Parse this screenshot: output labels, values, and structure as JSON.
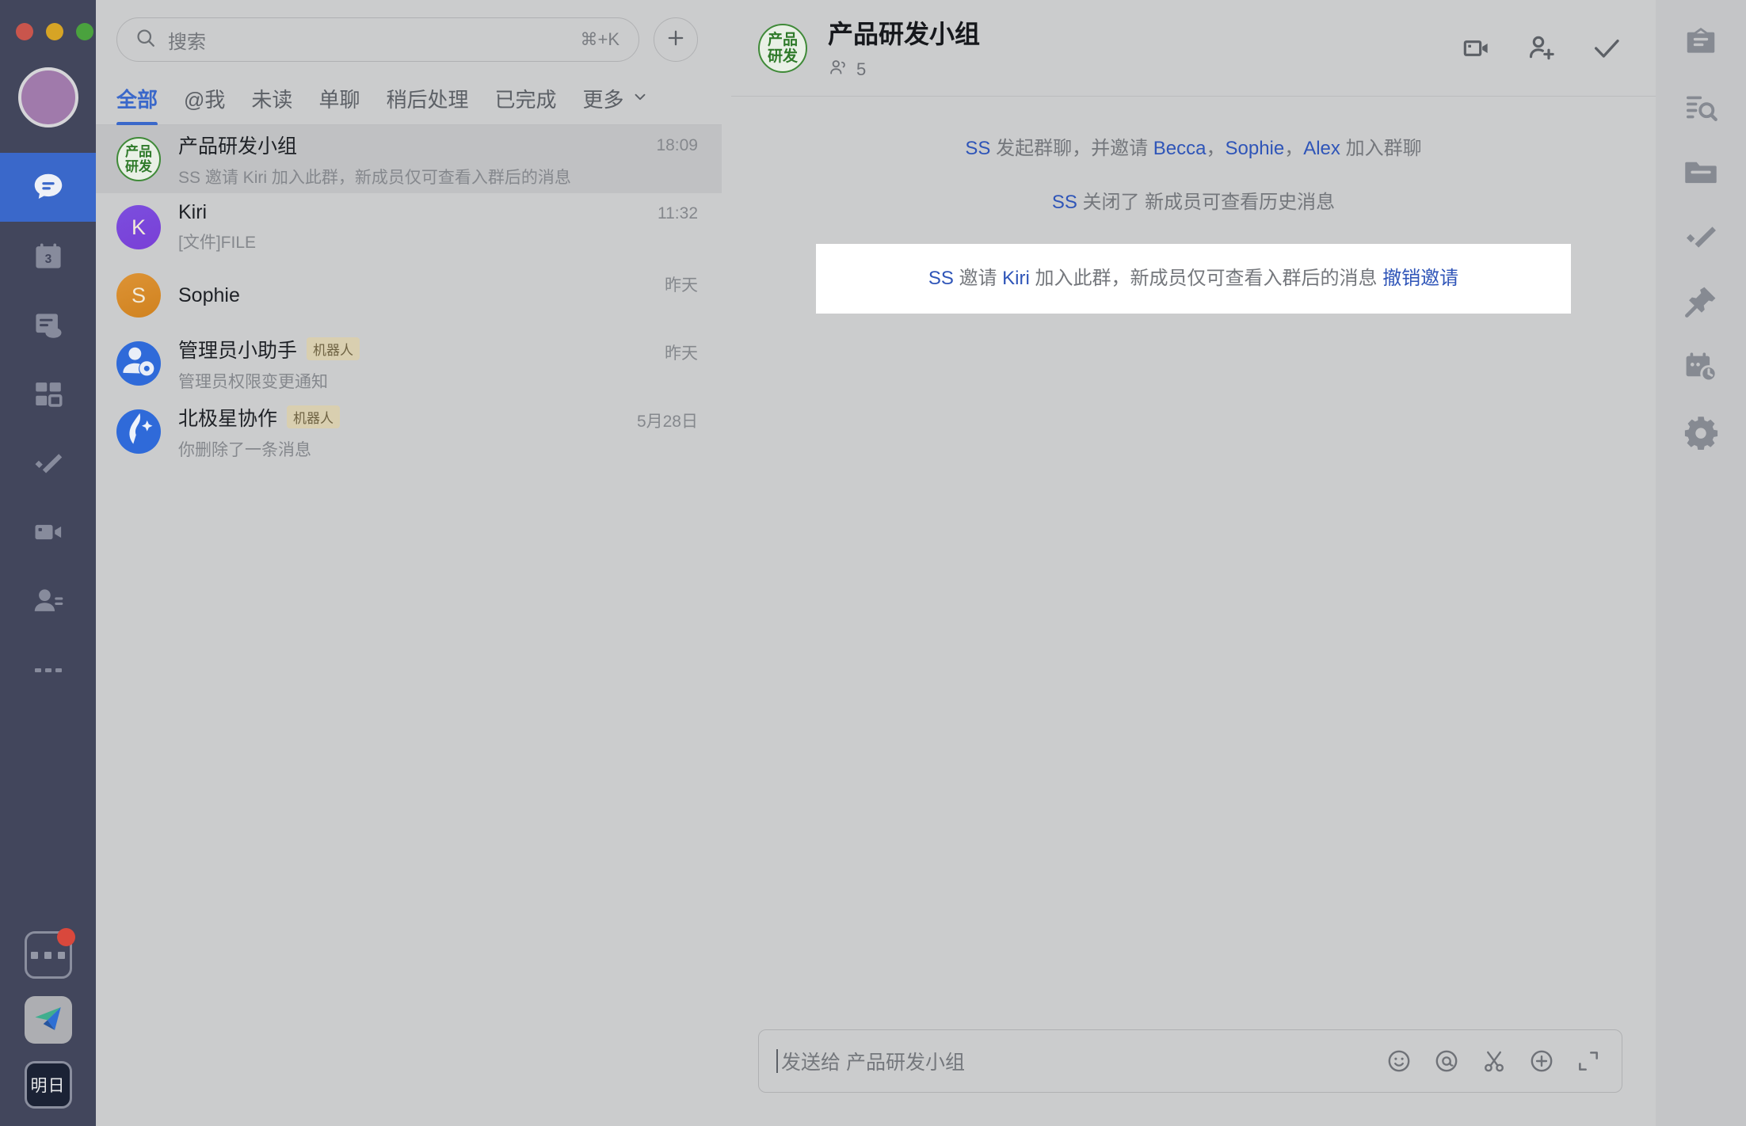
{
  "window": {
    "traffic_lights": [
      "close",
      "minimize",
      "maximize"
    ],
    "colors": {
      "accent": "#3a68ca",
      "rail_bg": "#42465c",
      "panel_bg": "#cbcccd",
      "group_green": "#3f8a38"
    }
  },
  "left_rail": {
    "avatar": "user-avatar",
    "items": [
      {
        "name": "chat",
        "icon": "chat-bubble-icon",
        "active": true
      },
      {
        "name": "calendar",
        "icon": "calendar-icon",
        "badge": "3",
        "active": false
      },
      {
        "name": "docs",
        "icon": "docs-cloud-icon",
        "active": false
      },
      {
        "name": "apps",
        "icon": "apps-grid-icon",
        "active": false
      },
      {
        "name": "tasks",
        "icon": "task-check-icon",
        "active": false
      },
      {
        "name": "video",
        "icon": "video-camera-icon",
        "active": false
      },
      {
        "name": "contacts",
        "icon": "contacts-icon",
        "active": false
      },
      {
        "name": "more",
        "icon": "more-dots-icon",
        "active": false
      }
    ],
    "bottom": [
      {
        "name": "workspace-more",
        "icon": "more-dots-box-icon",
        "badge_dot": true
      },
      {
        "name": "app-shortcut",
        "icon": "paper-plane-icon"
      },
      {
        "name": "status-tomorrow",
        "icon": "tomorrow-box",
        "label": "明日"
      }
    ]
  },
  "search": {
    "placeholder": "搜索",
    "shortcut": "⌘+K",
    "icon": "search-icon",
    "add_button": "plus-icon"
  },
  "tabs": [
    {
      "label": "全部",
      "active": true
    },
    {
      "label": "@我",
      "active": false
    },
    {
      "label": "未读",
      "active": false
    },
    {
      "label": "单聊",
      "active": false
    },
    {
      "label": "稍后处理",
      "active": false
    },
    {
      "label": "已完成",
      "active": false
    },
    {
      "label": "更多",
      "active": false,
      "chevron": true
    }
  ],
  "chat_list": [
    {
      "avatar_type": "group",
      "avatar_line1": "产品",
      "avatar_line2": "研发",
      "title": "产品研发小组",
      "badge": "",
      "preview": "SS 邀请 Kiri 加入此群，新成员仅可查看入群后的消息",
      "time": "18:09",
      "selected": true
    },
    {
      "avatar_type": "k",
      "avatar_letter": "K",
      "title": "Kiri",
      "badge": "",
      "preview": "[文件]FILE",
      "time": "11:32",
      "selected": false
    },
    {
      "avatar_type": "s",
      "avatar_letter": "S",
      "title": "Sophie",
      "badge": "",
      "preview": "",
      "time": "昨天",
      "selected": false
    },
    {
      "avatar_type": "bot1",
      "avatar_letter": "",
      "title": "管理员小助手",
      "badge": "机器人",
      "preview": "管理员权限变更通知",
      "time": "昨天",
      "selected": false
    },
    {
      "avatar_type": "bot2",
      "avatar_letter": "",
      "title": "北极星协作",
      "badge": "机器人",
      "preview": "你删除了一条消息",
      "time": "5月28日",
      "selected": false
    }
  ],
  "chat_header": {
    "avatar_line1": "产品",
    "avatar_line2": "研发",
    "title": "产品研发小组",
    "member_count": "5",
    "member_icon": "members-icon",
    "actions": [
      {
        "name": "video-call",
        "icon": "video-call-icon"
      },
      {
        "name": "add-member",
        "icon": "add-person-icon"
      },
      {
        "name": "mark-done",
        "icon": "check-icon"
      }
    ]
  },
  "messages": [
    {
      "type": "system",
      "highlighted": false,
      "parts": [
        {
          "text": "SS",
          "link": true
        },
        {
          "text": " 发起群聊，并邀请 ",
          "link": false
        },
        {
          "text": "Becca",
          "link": true
        },
        {
          "text": "，",
          "link": false
        },
        {
          "text": "Sophie",
          "link": true
        },
        {
          "text": "，",
          "link": false
        },
        {
          "text": "Alex",
          "link": true
        },
        {
          "text": " 加入群聊",
          "link": false
        }
      ]
    },
    {
      "type": "system",
      "highlighted": false,
      "parts": [
        {
          "text": "SS",
          "link": true
        },
        {
          "text": " 关闭了 新成员可查看历史消息",
          "link": false
        }
      ]
    },
    {
      "type": "system",
      "highlighted": true,
      "parts": [
        {
          "text": "SS",
          "link": true
        },
        {
          "text": " 邀请 ",
          "link": false
        },
        {
          "text": "Kiri",
          "link": true
        },
        {
          "text": " 加入此群，新成员仅可查看入群后的消息 ",
          "link": false
        },
        {
          "text": "撤销邀请",
          "link": true,
          "action": true
        }
      ]
    }
  ],
  "composer": {
    "placeholder": "发送给 产品研发小组",
    "tools": [
      {
        "name": "emoji",
        "icon": "emoji-icon"
      },
      {
        "name": "mention",
        "icon": "at-mention-icon"
      },
      {
        "name": "screenshot",
        "icon": "scissors-icon"
      },
      {
        "name": "more-attach",
        "icon": "plus-circle-icon"
      },
      {
        "name": "expand",
        "icon": "expand-icon"
      }
    ]
  },
  "right_rail": [
    {
      "name": "announcement",
      "icon": "announcement-icon"
    },
    {
      "name": "search-messages",
      "icon": "search-list-icon"
    },
    {
      "name": "files",
      "icon": "folder-icon"
    },
    {
      "name": "tasks",
      "icon": "task-check-icon"
    },
    {
      "name": "pinned",
      "icon": "pin-icon"
    },
    {
      "name": "schedule",
      "icon": "calendar-clock-icon"
    },
    {
      "name": "settings",
      "icon": "gear-icon"
    }
  ],
  "cursor": {
    "icon": "tap-hand-cursor"
  }
}
